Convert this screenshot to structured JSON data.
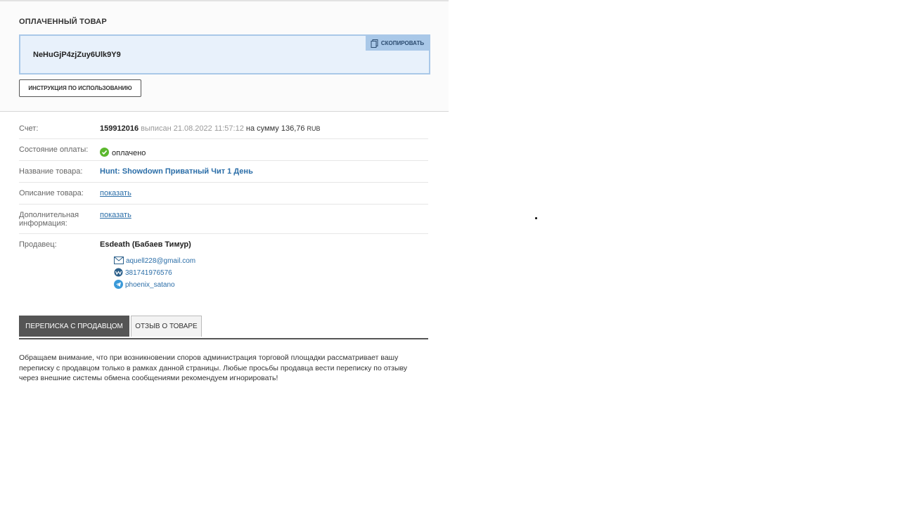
{
  "purchased": {
    "title": "ОПЛАЧЕННЫЙ ТОВАР",
    "code": "NeHuGjP4zjZuy6Ulk9Y9",
    "copy_label": "СКОПИРОВАТЬ",
    "instruction_label": "ИНСТРУКЦИЯ ПО ИСПОЛЬЗОВАНИЮ"
  },
  "info": {
    "invoice": {
      "label": "Счет:",
      "number": "159912016",
      "issued_text": "выписан 21.08.2022 11:57:12",
      "amount_text": "на сумму 136,76",
      "currency": "RUB"
    },
    "payment_status": {
      "label": "Состояние оплаты:",
      "value": "оплачено"
    },
    "product_name": {
      "label": "Название товара:",
      "value": "Hunt: Showdown Приватный Чит 1 День"
    },
    "product_description": {
      "label": "Описание товара:",
      "link": "показать"
    },
    "additional_info": {
      "label": "Дополнительная информация:",
      "link": "показать"
    },
    "seller": {
      "label": "Продавец:",
      "name": "Esdeath (Бабаев Тимур)",
      "email": "aquell228@gmail.com",
      "webmoney": "381741976576",
      "telegram": "phoenix_satano"
    }
  },
  "tabs": [
    {
      "label": "ПЕРЕПИСКА С ПРОДАВЦОМ",
      "active": true
    },
    {
      "label": "ОТЗЫВ О ТОВАРЕ",
      "active": false
    }
  ],
  "notice": "Обращаем внимание, что при возникновении споров администрация торговой площадки рассматривает вашу переписку с продавцом только в рамках данной страницы. Любые просьбы продавца вести переписку по отзыву через внешние системы обмена сообщениями рекомендуем игнорировать!",
  "colors": {
    "accent": "#2b6ea8",
    "code_bg": "#e8f1fb",
    "code_border": "#a9c8e8",
    "tab_active": "#555555",
    "paid_green": "#5cb82e"
  },
  "icons": [
    "copy-icon",
    "check-circle-icon",
    "mail-icon",
    "webmoney-icon",
    "telegram-icon"
  ]
}
